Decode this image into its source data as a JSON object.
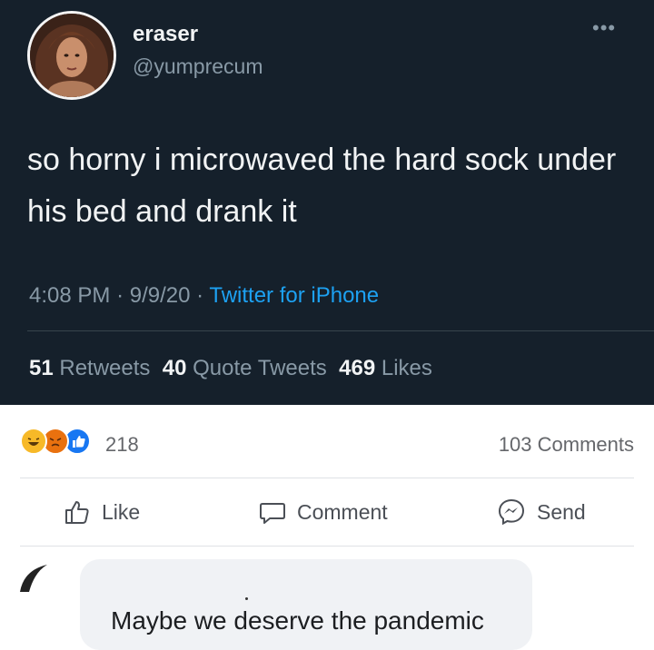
{
  "tweet": {
    "display_name": "eraser",
    "handle": "@yumprecum",
    "more_icon": "more-icon",
    "text": "so horny i microwaved the hard sock under his bed and drank it",
    "time": "4:08 PM",
    "date": "9/9/20",
    "separator": "·",
    "source": "Twitter for iPhone",
    "stats": {
      "retweets_count": "51",
      "retweets_label": "Retweets",
      "quotes_count": "40",
      "quotes_label": "Quote Tweets",
      "likes_count": "469",
      "likes_label": "Likes"
    },
    "colors": {
      "background": "#15202b",
      "link": "#1da1f2",
      "muted": "#8899a6"
    }
  },
  "facebook": {
    "reaction_icons": [
      "haha-icon",
      "angry-icon",
      "like-icon"
    ],
    "reaction_count": "218",
    "comments_count": "103 Comments",
    "actions": {
      "like": "Like",
      "comment": "Comment",
      "send": "Send"
    },
    "comment": {
      "text": "Maybe we deserve the pandemic"
    }
  }
}
